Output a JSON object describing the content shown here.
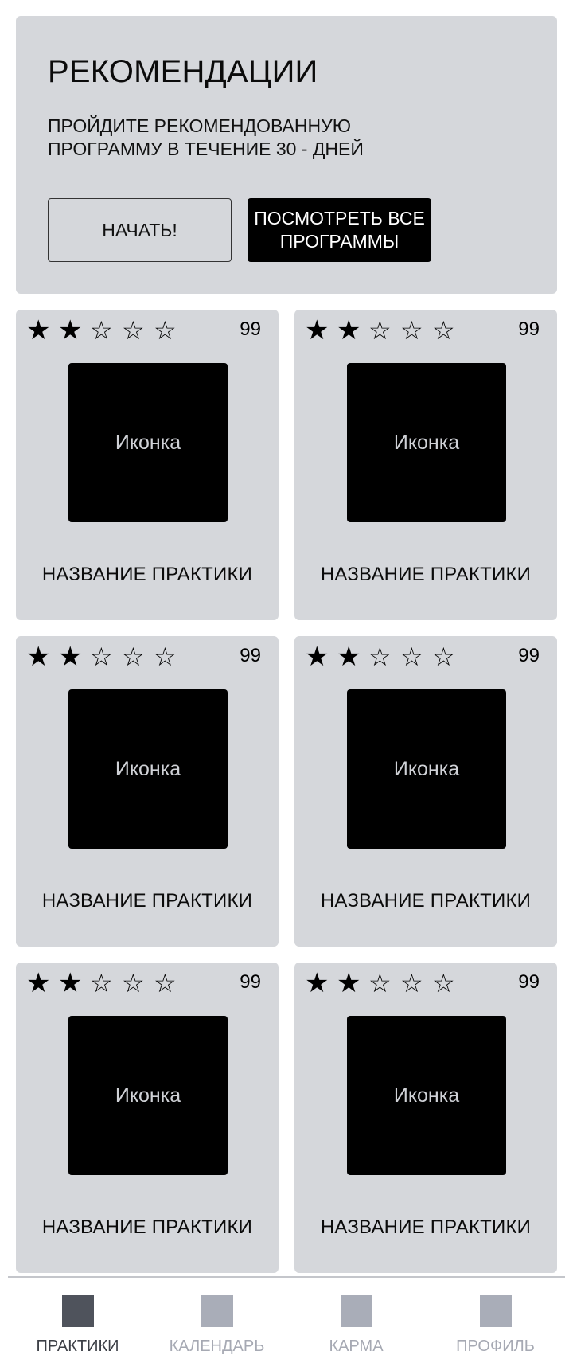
{
  "banner": {
    "title": "РЕКОМЕНДАЦИИ",
    "subtitle": "ПРОЙДИТЕ РЕКОМЕНДОВАННУЮ ПРОГРАММУ В ТЕЧЕНИЕ 30 - ДНЕЙ",
    "start_label": "НАЧАТЬ!",
    "all_programs_label": "ПОСМОТРЕТЬ ВСЕ ПРОГРАММЫ"
  },
  "practices": [
    {
      "rating": 2,
      "rating_max": 5,
      "count": "99",
      "icon_label": "Иконка",
      "title": "НАЗВАНИЕ ПРАКТИКИ"
    },
    {
      "rating": 2,
      "rating_max": 5,
      "count": "99",
      "icon_label": "Иконка",
      "title": "НАЗВАНИЕ ПРАКТИКИ"
    },
    {
      "rating": 2,
      "rating_max": 5,
      "count": "99",
      "icon_label": "Иконка",
      "title": "НАЗВАНИЕ ПРАКТИКИ"
    },
    {
      "rating": 2,
      "rating_max": 5,
      "count": "99",
      "icon_label": "Иконка",
      "title": "НАЗВАНИЕ ПРАКТИКИ"
    },
    {
      "rating": 2,
      "rating_max": 5,
      "count": "99",
      "icon_label": "Иконка",
      "title": "НАЗВАНИЕ ПРАКТИКИ"
    },
    {
      "rating": 2,
      "rating_max": 5,
      "count": "99",
      "icon_label": "Иконка",
      "title": "НАЗВАНИЕ ПРАКТИКИ"
    }
  ],
  "nav": {
    "items": [
      {
        "label": "ПРАКТИКИ",
        "icon": "practices-icon",
        "active": true
      },
      {
        "label": "КАЛЕНДАРЬ",
        "icon": "calendar-icon",
        "active": false
      },
      {
        "label": "КАРМА",
        "icon": "karma-icon",
        "active": false
      },
      {
        "label": "ПРОФИЛЬ",
        "icon": "profile-icon",
        "active": false
      }
    ]
  },
  "colors": {
    "card_bg": "#d5d7db",
    "nav_active": "#4f535c",
    "nav_inactive": "#a9adb8"
  }
}
